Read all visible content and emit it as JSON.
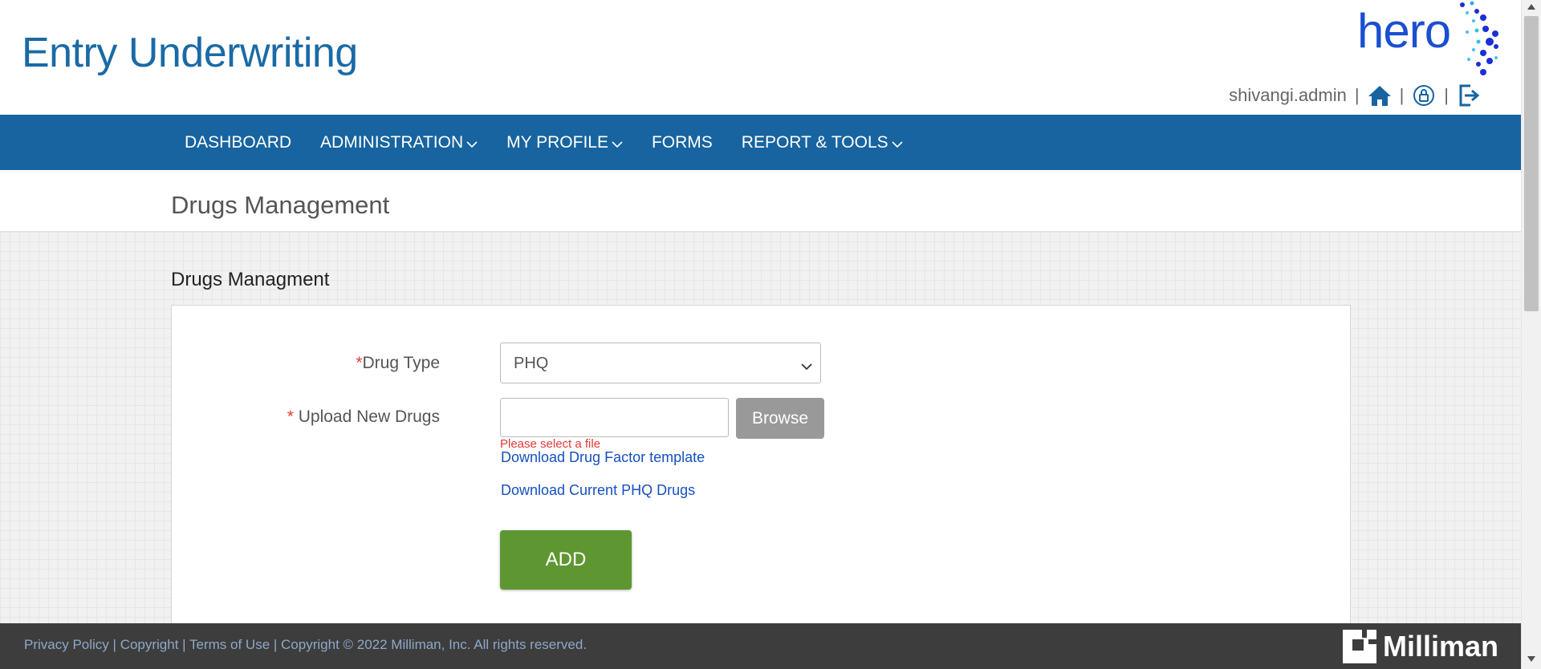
{
  "header": {
    "app_title": "Entry Underwriting",
    "brand_logo_text": "hero",
    "username": "shivangi.admin",
    "separator": "|",
    "icons": [
      "home-icon",
      "unlock-icon",
      "logout-icon"
    ]
  },
  "nav": {
    "items": [
      {
        "label": "DASHBOARD",
        "dropdown": false
      },
      {
        "label": "ADMINISTRATION",
        "dropdown": true
      },
      {
        "label": "MY PROFILE",
        "dropdown": true
      },
      {
        "label": "FORMS",
        "dropdown": false
      },
      {
        "label": "REPORT & TOOLS",
        "dropdown": true
      }
    ]
  },
  "page": {
    "title": "Drugs Management",
    "section_title": "Drugs Managment"
  },
  "form": {
    "drug_type": {
      "required_mark": "*",
      "label": "Drug Type",
      "selected_value": "PHQ"
    },
    "upload": {
      "required_mark": "*",
      "label": " Upload New Drugs",
      "value": "",
      "browse_label": "Browse",
      "error": "Please select a file"
    },
    "links": {
      "template": "Download Drug Factor template",
      "current": "Download Current PHQ Drugs"
    },
    "add_label": "ADD"
  },
  "footer": {
    "privacy": "Privacy Policy",
    "copyright_link": "Copyright",
    "terms": "Terms of Use",
    "copyright_text": "Copyright © 2022 Milliman, Inc. All rights reserved.",
    "separator": " | ",
    "company_name": "Milliman"
  },
  "colors": {
    "nav_bg": "#1764a0",
    "title_blue": "#1a6aa6",
    "add_green": "#5e9732",
    "link_blue": "#1550c0",
    "error_red": "#e53935",
    "footer_bg": "#3d3d3d"
  }
}
